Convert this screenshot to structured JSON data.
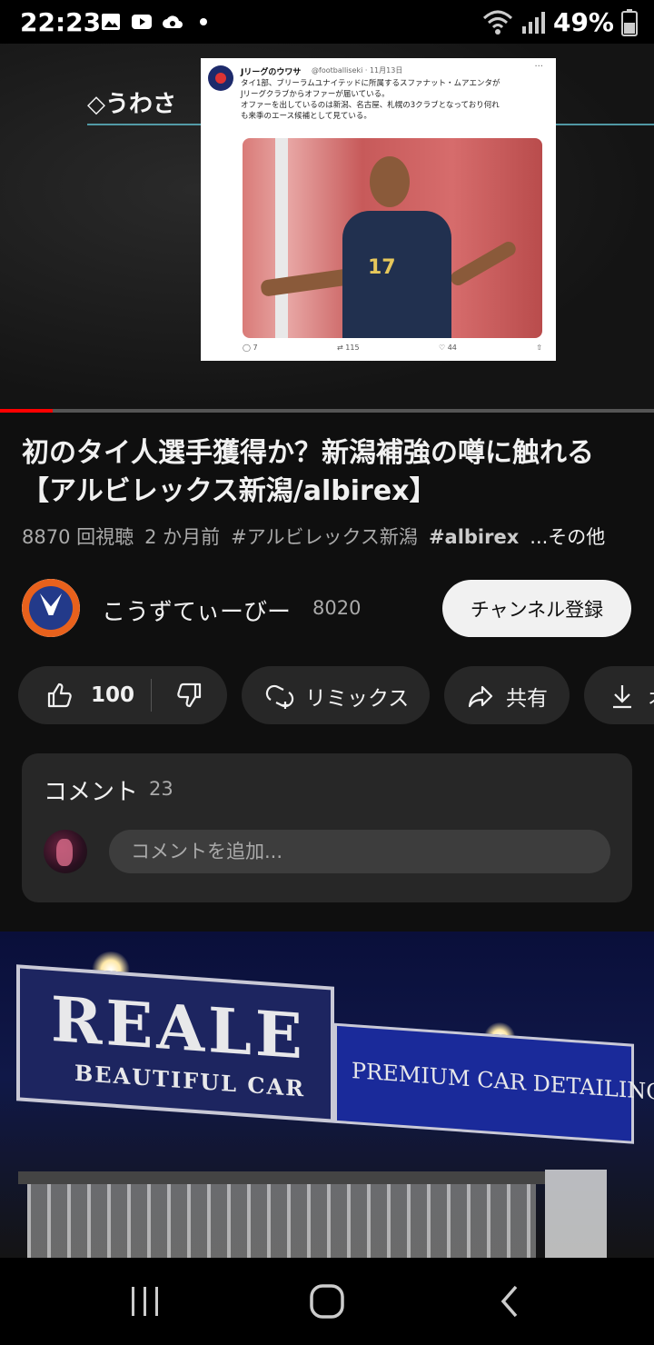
{
  "status_bar": {
    "time": "22:23",
    "battery": "49%",
    "icons_left": [
      "gallery-icon",
      "youtube-icon",
      "cloud-icon",
      "dot-icon"
    ],
    "icons_right": [
      "wifi-icon",
      "signal-icon",
      "battery-icon"
    ]
  },
  "player": {
    "overlay_tag": "◇うわさ",
    "progress_fraction": 0.08,
    "tweet": {
      "name": "Jリーグのウワサ",
      "handle": "@footballiseki · 11月13日",
      "lines": [
        "タイ1部、ブリーラムユナイテッドに所属するスファナット・ムアエンタが",
        "Jリーグクラブからオファーが届いている。",
        "オファーを出しているのは新潟、名古屋、札幌の3クラブとなっており何れ",
        "も来季のエース候補として見ている。"
      ],
      "jersey_number": "17",
      "replies": "7",
      "retweets": "115",
      "likes": "44"
    }
  },
  "video": {
    "title": "初のタイ人選手獲得か？新潟補強の噂に触れる【アルビレックス新潟/albirex】",
    "views": "8870 回視聴",
    "age": "2 か月前",
    "hashtag1": "#アルビレックス新潟",
    "hashtag2": "#albirex",
    "more": "...その他"
  },
  "channel": {
    "name": "こうずてぃーびー",
    "subscribers": "8020",
    "subscribe_label": "チャンネル登録"
  },
  "actions": {
    "like_count": "100",
    "remix_label": "リミックス",
    "share_label": "共有",
    "download_label": "オ"
  },
  "comments": {
    "title": "コメント",
    "count": "23",
    "placeholder": "コメントを追加..."
  },
  "next_video": {
    "sign_brand": "REALE",
    "sign_sub": "BEAUTIFUL CAR",
    "sign_tag": "PREMIUM CAR DETAILING"
  },
  "nav_bar": {
    "buttons": [
      "recent-apps-icon",
      "home-icon",
      "back-icon"
    ]
  },
  "colors": {
    "background": "#0f0f0f",
    "pill": "#272727",
    "progress": "#ff0000",
    "subscribe_bg": "#f1f1f1"
  }
}
